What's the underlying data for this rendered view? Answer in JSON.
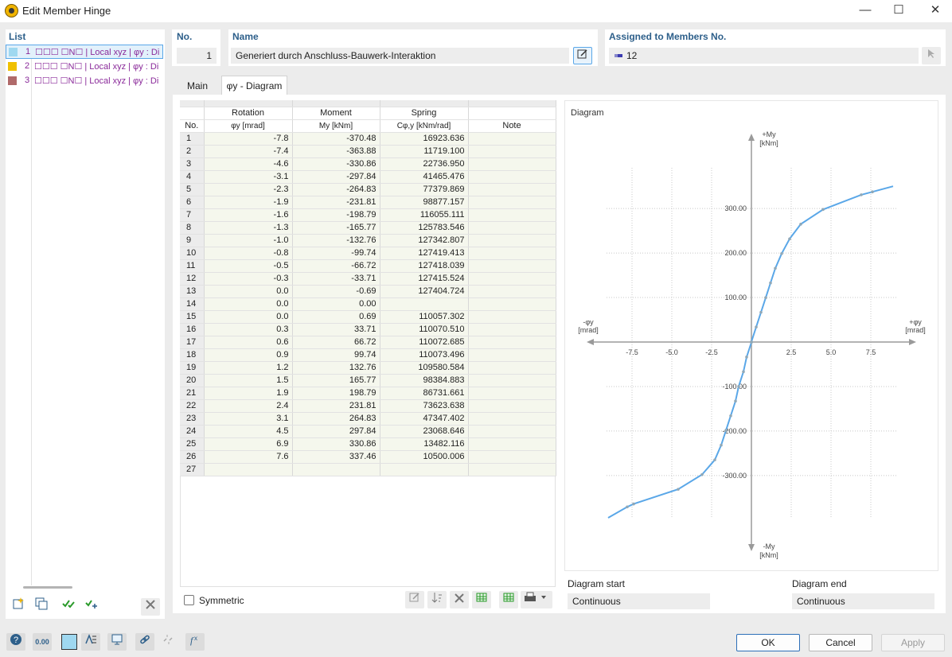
{
  "window": {
    "title": "Edit Member Hinge",
    "minimize": "—",
    "maximize": "☐",
    "close": "✕"
  },
  "list": {
    "header": "List",
    "items": [
      {
        "num": "1",
        "desc": "☐☐☐  ☐N☐ | Local xyz | φy : Di",
        "color": "#9fd8f0",
        "selected": true
      },
      {
        "num": "2",
        "desc": "☐☐☐  ☐N☐ | Local xyz | φy : Di",
        "color": "#f0c000",
        "selected": false
      },
      {
        "num": "3",
        "desc": "☐☐☐  ☐N☐ | Local xyz | φy : Di",
        "color": "#b06a6a",
        "selected": false
      }
    ]
  },
  "header": {
    "no_label": "No.",
    "no_value": "1",
    "name_label": "Name",
    "name_value": "Generiert durch Anschluss-Bauwerk-Interaktion",
    "assigned_label": "Assigned to Members No.",
    "assigned_value": "12"
  },
  "tabs": [
    {
      "label": "Main",
      "active": false
    },
    {
      "label": "φy - Diagram",
      "active": true
    }
  ],
  "table": {
    "headers": {
      "no": "No.",
      "rotation": "Rotation",
      "rotation_sub": "φy [mrad]",
      "moment": "Moment",
      "moment_sub": "My [kNm]",
      "spring": "Spring",
      "spring_sub": "Cφ,y [kNm/rad]",
      "note": "Note"
    },
    "rows": [
      [
        "1",
        "-7.8",
        "-370.48",
        "16923.636"
      ],
      [
        "2",
        "-7.4",
        "-363.88",
        "11719.100"
      ],
      [
        "3",
        "-4.6",
        "-330.86",
        "22736.950"
      ],
      [
        "4",
        "-3.1",
        "-297.84",
        "41465.476"
      ],
      [
        "5",
        "-2.3",
        "-264.83",
        "77379.869"
      ],
      [
        "6",
        "-1.9",
        "-231.81",
        "98877.157"
      ],
      [
        "7",
        "-1.6",
        "-198.79",
        "116055.111"
      ],
      [
        "8",
        "-1.3",
        "-165.77",
        "125783.546"
      ],
      [
        "9",
        "-1.0",
        "-132.76",
        "127342.807"
      ],
      [
        "10",
        "-0.8",
        "-99.74",
        "127419.413"
      ],
      [
        "11",
        "-0.5",
        "-66.72",
        "127418.039"
      ],
      [
        "12",
        "-0.3",
        "-33.71",
        "127415.524"
      ],
      [
        "13",
        "0.0",
        "-0.69",
        "127404.724"
      ],
      [
        "14",
        "0.0",
        "0.00",
        ""
      ],
      [
        "15",
        "0.0",
        "0.69",
        "110057.302"
      ],
      [
        "16",
        "0.3",
        "33.71",
        "110070.510"
      ],
      [
        "17",
        "0.6",
        "66.72",
        "110072.685"
      ],
      [
        "18",
        "0.9",
        "99.74",
        "110073.496"
      ],
      [
        "19",
        "1.2",
        "132.76",
        "109580.584"
      ],
      [
        "20",
        "1.5",
        "165.77",
        "98384.883"
      ],
      [
        "21",
        "1.9",
        "198.79",
        "86731.661"
      ],
      [
        "22",
        "2.4",
        "231.81",
        "73623.638"
      ],
      [
        "23",
        "3.1",
        "264.83",
        "47347.402"
      ],
      [
        "24",
        "4.5",
        "297.84",
        "23068.646"
      ],
      [
        "25",
        "6.9",
        "330.86",
        "13482.116"
      ],
      [
        "26",
        "7.6",
        "337.46",
        "10500.006"
      ],
      [
        "27",
        "",
        "",
        ""
      ]
    ]
  },
  "symmetric_label": "Symmetric",
  "diagram": {
    "title": "Diagram",
    "y_pos_label": "+My",
    "y_neg_label": "-My",
    "y_unit": "[kNm]",
    "x_pos_label": "+φy",
    "x_neg_label": "-φy",
    "x_unit": "[mrad]",
    "x_ticks": [
      -7.5,
      -5.0,
      -2.5,
      2.5,
      5.0,
      7.5
    ],
    "y_ticks": [
      -300,
      -200,
      -100,
      100,
      200,
      300
    ],
    "curve_color": "#5aa7e8"
  },
  "chart_data": {
    "type": "line",
    "title": "Diagram",
    "xlabel": "φy [mrad]",
    "ylabel": "My [kNm]",
    "xlim": [
      -9,
      9.5
    ],
    "ylim": [
      -460,
      480
    ],
    "grid": true,
    "series": [
      {
        "x": [
          -7.8,
          -7.4,
          -4.6,
          -3.1,
          -2.3,
          -1.9,
          -1.6,
          -1.3,
          -1.0,
          -0.8,
          -0.5,
          -0.3,
          0.0,
          0.0,
          0.0,
          0.3,
          0.6,
          0.9,
          1.2,
          1.5,
          1.9,
          2.4,
          3.1,
          4.5,
          6.9,
          7.6
        ],
        "y": [
          -370.48,
          -363.88,
          -330.86,
          -297.84,
          -264.83,
          -231.81,
          -198.79,
          -165.77,
          -132.76,
          -99.74,
          -66.72,
          -33.71,
          -0.69,
          0.0,
          0.69,
          33.71,
          66.72,
          99.74,
          132.76,
          165.77,
          198.79,
          231.81,
          264.83,
          297.84,
          330.86,
          337.46
        ],
        "extend_start": [
          -9.0,
          -395.0
        ],
        "extend_end": [
          8.9,
          350.0
        ]
      }
    ]
  },
  "diagram_start": {
    "label": "Diagram start",
    "value": "Continuous"
  },
  "diagram_end": {
    "label": "Diagram end",
    "value": "Continuous"
  },
  "footer": {
    "ok": "OK",
    "cancel": "Cancel",
    "apply": "Apply",
    "zero_label": "0.00"
  }
}
